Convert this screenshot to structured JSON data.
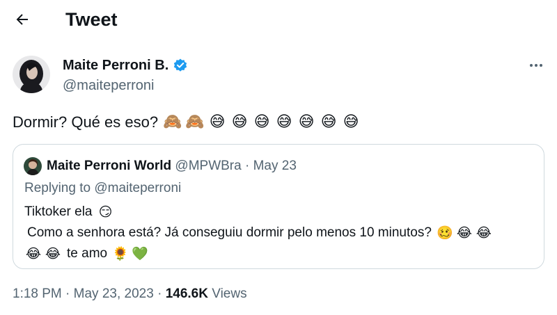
{
  "header": {
    "title": "Tweet",
    "back_icon": "arrow-left-icon"
  },
  "tweet": {
    "author_name": "Maite Perroni B.",
    "author_handle": "@maiteperroni",
    "verified_icon": "verified-badge-icon",
    "more_icon": "more-horizontal-icon",
    "text": "Dormir? Qué es eso?",
    "emojis": [
      "🙈",
      "🙈",
      "😅",
      "😅",
      "😅",
      "😅",
      "😅",
      "😅",
      "😅"
    ]
  },
  "quoted_tweet": {
    "author_name": "Maite Perroni World",
    "author_handle": "@MPWBra",
    "separator": "·",
    "date": "May 23",
    "replying_label": "Replying to",
    "replying_handle": "@maiteperroni",
    "line1_text": "Tiktoker ela",
    "line1_emoji": "😏",
    "line2_text": "Como a senhora está? Já conseguiu dormir pelo menos 10 minutos?",
    "line2_emojis": [
      "🥴",
      "😂",
      "😂"
    ],
    "line3_emojis": [
      "😂",
      "😂"
    ],
    "line3_text": "te amo",
    "line3_end_emojis": [
      "🌻",
      "💚"
    ]
  },
  "footer": {
    "time": "1:18 PM",
    "separator": "·",
    "date": "May 23, 2023",
    "views_count": "146.6K",
    "views_label": "Views"
  },
  "colors": {
    "text_primary": "#0f1419",
    "text_secondary": "#536471",
    "verified_blue": "#1d9bf0",
    "border": "#cfd9de"
  }
}
